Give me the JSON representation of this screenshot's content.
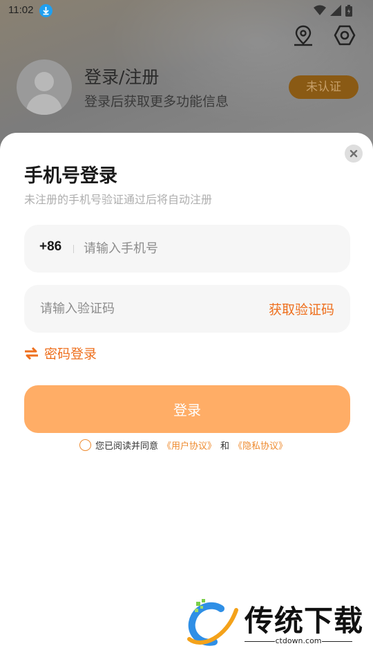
{
  "status_bar": {
    "time": "11:02"
  },
  "profile": {
    "title": "登录/注册",
    "subtitle": "登录后获取更多功能信息",
    "badge": "未认证"
  },
  "login_sheet": {
    "title": "手机号登录",
    "subtitle": "未注册的手机号验证通过后将自动注册",
    "phone": {
      "country_code": "+86",
      "placeholder": "请输入手机号",
      "value": ""
    },
    "code": {
      "placeholder": "请输入验证码",
      "value": "",
      "get_code_label": "获取验证码"
    },
    "switch_label": "密码登录",
    "login_button": "登录",
    "agreement": {
      "prefix": "您已阅读并同意",
      "user_agreement": "《用户协议》",
      "conjunction": "和",
      "privacy_agreement": "《隐私协议》",
      "checked": false
    }
  },
  "watermark": {
    "name": "传统下载",
    "url": "ctdown.com"
  },
  "colors": {
    "accent": "#ee6f1d",
    "button": "#ffad66",
    "field_bg": "#f6f6f6"
  }
}
